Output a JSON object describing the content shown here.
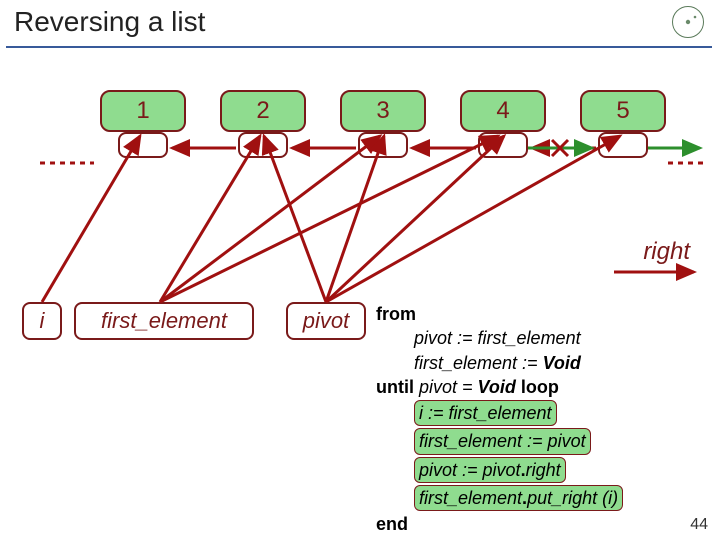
{
  "title": "Reversing a list",
  "nodes": [
    "1",
    "2",
    "3",
    "4",
    "5"
  ],
  "right_label": "right",
  "vars": {
    "i": "i",
    "first_element": "first_element",
    "pivot": "pivot"
  },
  "code": {
    "from": "from",
    "l1": "pivot := first_element",
    "l2a": "first_element := ",
    "l2b": "Void",
    "until": "until",
    "cond_a": " pivot = ",
    "cond_b": "Void",
    "loop": " loop",
    "h1": "i := first_element",
    "h2": "first_element := pivot",
    "h3_a": "pivot := pivot",
    "h3_b": ".",
    "h3_c": "right",
    "h4_a": "first_element",
    "h4_b": ".",
    "h4_c": "put_right (i)",
    "end": "end"
  },
  "pagenum": "44",
  "colors": {
    "red": "#a01010",
    "green": "#2d8f2d",
    "node_border": "#7a1a1a"
  }
}
